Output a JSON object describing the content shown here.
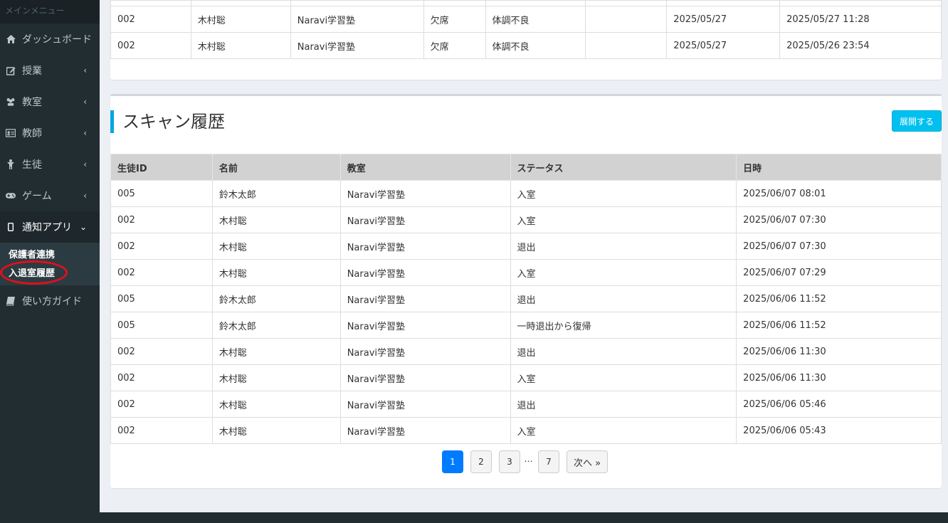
{
  "sidebar": {
    "header": "メインメニュー",
    "items": [
      {
        "label": "ダッシュボード",
        "icon": "home-icon",
        "chev": ""
      },
      {
        "label": "授業",
        "icon": "edit-icon",
        "chev": "‹"
      },
      {
        "label": "教室",
        "icon": "users-icon",
        "chev": "‹"
      },
      {
        "label": "教師",
        "icon": "id-card-icon",
        "chev": "‹"
      },
      {
        "label": "生徒",
        "icon": "child-icon",
        "chev": "‹"
      },
      {
        "label": "ゲーム",
        "icon": "gamepad-icon",
        "chev": "‹"
      },
      {
        "label": "通知アプリ",
        "icon": "mobile-icon",
        "chev": "⌄"
      }
    ],
    "submenu": [
      {
        "label": "保護者連携"
      },
      {
        "label": "入退室履歴"
      }
    ],
    "guide": {
      "label": "使い方ガイド",
      "icon": "book-icon"
    }
  },
  "top_table": {
    "rows": [
      [
        "002",
        "木村聡",
        "Naravi学習塾",
        "欠席",
        "体調不良",
        "",
        "2025/05/27",
        "2025/05/27 11:28"
      ],
      [
        "002",
        "木村聡",
        "Naravi学習塾",
        "欠席",
        "体調不良",
        "",
        "2025/05/27",
        "2025/05/26 23:54"
      ]
    ]
  },
  "scan": {
    "title": "スキャン履歴",
    "expand_label": "展開する",
    "headers": [
      "生徒ID",
      "名前",
      "教室",
      "ステータス",
      "日時"
    ],
    "rows": [
      [
        "005",
        "鈴木太郎",
        "Naravi学習塾",
        "入室",
        "2025/06/07 08:01"
      ],
      [
        "002",
        "木村聡",
        "Naravi学習塾",
        "入室",
        "2025/06/07 07:30"
      ],
      [
        "002",
        "木村聡",
        "Naravi学習塾",
        "退出",
        "2025/06/07 07:30"
      ],
      [
        "002",
        "木村聡",
        "Naravi学習塾",
        "入室",
        "2025/06/07 07:29"
      ],
      [
        "005",
        "鈴木太郎",
        "Naravi学習塾",
        "退出",
        "2025/06/06 11:52"
      ],
      [
        "005",
        "鈴木太郎",
        "Naravi学習塾",
        "一時退出から復帰",
        "2025/06/06 11:52"
      ],
      [
        "002",
        "木村聡",
        "Naravi学習塾",
        "退出",
        "2025/06/06 11:30"
      ],
      [
        "002",
        "木村聡",
        "Naravi学習塾",
        "入室",
        "2025/06/06 11:30"
      ],
      [
        "002",
        "木村聡",
        "Naravi学習塾",
        "退出",
        "2025/06/06 05:46"
      ],
      [
        "002",
        "木村聡",
        "Naravi学習塾",
        "入室",
        "2025/06/06 05:43"
      ]
    ]
  },
  "pagination": {
    "pages": [
      "1",
      "2",
      "3"
    ],
    "dots": "…",
    "last": "7",
    "next": "次へ »",
    "current": "1"
  },
  "colors": {
    "accent": "#00a7e1",
    "button": "#00c0ef",
    "active_page": "#007bff",
    "highlight": "#e0101e"
  }
}
